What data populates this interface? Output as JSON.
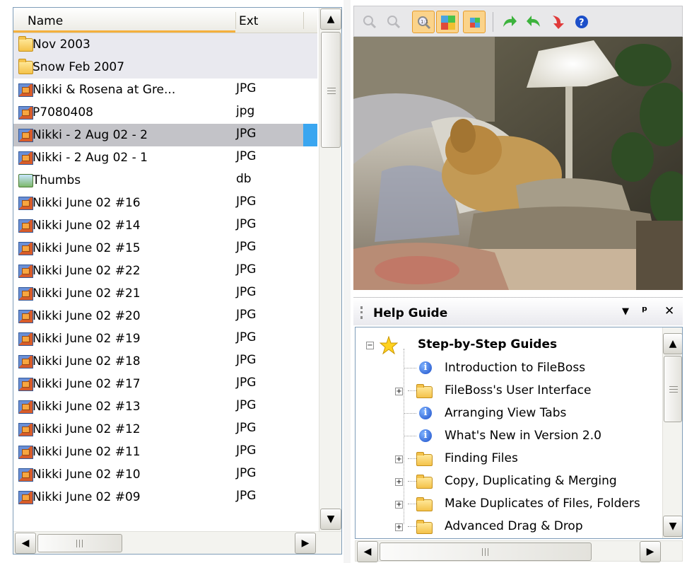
{
  "file_list": {
    "columns": {
      "name": "Name",
      "ext": "Ext"
    },
    "rows": [
      {
        "name": "Nov 2003",
        "ext": "",
        "icon": "folder-icon"
      },
      {
        "name": "Snow Feb 2007",
        "ext": "",
        "icon": "folder-icon"
      },
      {
        "name": "Nikki & Rosena at Gre...",
        "ext": "JPG",
        "icon": "jpg-file-icon"
      },
      {
        "name": "P7080408",
        "ext": "jpg",
        "icon": "jpg-file-icon"
      },
      {
        "name": "Nikki - 2 Aug 02 -  2",
        "ext": "JPG",
        "icon": "jpg-file-icon",
        "selected": true
      },
      {
        "name": "Nikki - 2 Aug 02 -  1",
        "ext": "JPG",
        "icon": "jpg-file-icon"
      },
      {
        "name": "Thumbs",
        "ext": "db",
        "icon": "database-file-icon"
      },
      {
        "name": "Nikki June 02 #16",
        "ext": "JPG",
        "icon": "jpg-file-icon"
      },
      {
        "name": "Nikki June 02 #14",
        "ext": "JPG",
        "icon": "jpg-file-icon"
      },
      {
        "name": "Nikki June 02 #15",
        "ext": "JPG",
        "icon": "jpg-file-icon"
      },
      {
        "name": "Nikki June 02 #22",
        "ext": "JPG",
        "icon": "jpg-file-icon"
      },
      {
        "name": "Nikki June 02 #21",
        "ext": "JPG",
        "icon": "jpg-file-icon"
      },
      {
        "name": "Nikki June 02 #20",
        "ext": "JPG",
        "icon": "jpg-file-icon"
      },
      {
        "name": "Nikki June 02 #19",
        "ext": "JPG",
        "icon": "jpg-file-icon"
      },
      {
        "name": "Nikki June 02 #18",
        "ext": "JPG",
        "icon": "jpg-file-icon"
      },
      {
        "name": "Nikki June 02 #17",
        "ext": "JPG",
        "icon": "jpg-file-icon"
      },
      {
        "name": "Nikki June 02 #13",
        "ext": "JPG",
        "icon": "jpg-file-icon"
      },
      {
        "name": "Nikki June 02 #12",
        "ext": "JPG",
        "icon": "jpg-file-icon"
      },
      {
        "name": "Nikki June 02 #11",
        "ext": "JPG",
        "icon": "jpg-file-icon"
      },
      {
        "name": "Nikki June 02 #10",
        "ext": "JPG",
        "icon": "jpg-file-icon"
      },
      {
        "name": "Nikki June 02 #09",
        "ext": "JPG",
        "icon": "jpg-file-icon"
      }
    ]
  },
  "preview_toolbar": {
    "buttons": [
      "zoom-in-icon",
      "zoom-out-icon",
      "actual-size-icon",
      "fit-image-icon",
      "best-fit-icon",
      "forward-icon",
      "back-icon",
      "redo-icon",
      "help-icon"
    ]
  },
  "help_guide": {
    "title": "Help Guide",
    "controls": {
      "dropdown": "▾",
      "pin": "ᴾ",
      "close": "×"
    },
    "root": "Step-by-Step Guides",
    "items": [
      {
        "label": "Introduction to FileBoss",
        "type": "page"
      },
      {
        "label": "FileBoss's User Interface",
        "type": "folder"
      },
      {
        "label": "Arranging View Tabs",
        "type": "page"
      },
      {
        "label": "What's New in Version 2.0",
        "type": "page"
      },
      {
        "label": "Finding Files",
        "type": "folder"
      },
      {
        "label": "Copy, Duplicating & Merging",
        "type": "folder"
      },
      {
        "label": "Make Duplicates of Files, Folders",
        "type": "folder"
      },
      {
        "label": "Advanced Drag & Drop",
        "type": "folder"
      }
    ]
  },
  "colors": {
    "selection": "#c3c3c8",
    "selection_marker": "#3aa6f0",
    "sort_indicator": "#f4b03d",
    "toolbar_active": "#fbd38a"
  }
}
